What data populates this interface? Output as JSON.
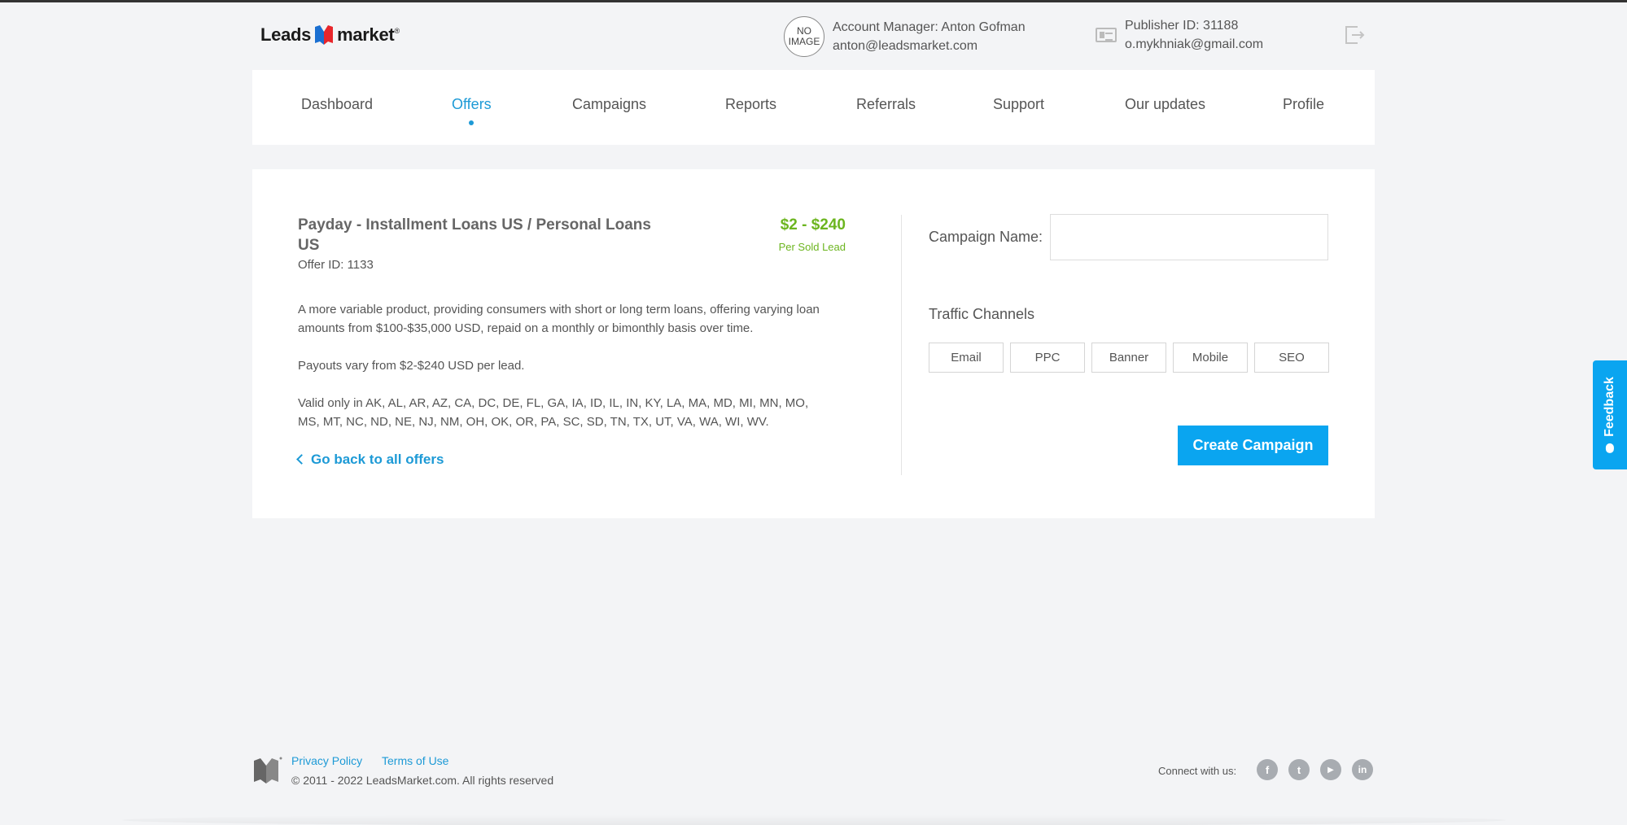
{
  "header": {
    "logo_left": "Leads",
    "logo_right": "market",
    "logo_reg": "®",
    "avatar_text": "NO IMAGE",
    "account_manager": "Account Manager: Anton Gofman",
    "manager_email": "anton@leadsmarket.com",
    "publisher_id": "Publisher ID: 31188",
    "publisher_email": "o.mykhniak@gmail.com"
  },
  "nav": {
    "items": [
      "Dashboard",
      "Offers",
      "Campaigns",
      "Reports",
      "Referrals",
      "Support",
      "Our updates",
      "Profile"
    ],
    "active": "Offers"
  },
  "offer": {
    "title": "Payday - Installment Loans US / Personal Loans US",
    "offer_id": "Offer ID: 1133",
    "price": "$2 - $240",
    "price_sub": "Per Sold Lead",
    "description": "A more variable product, providing consumers with short or long term loans, offering varying loan amounts from $100-$35,000 USD, repaid on a monthly or bimonthly basis over time.",
    "payouts": "Payouts vary from $2-$240 USD per lead.",
    "valid": "Valid only in AK, AL, AR, AZ, CA, DC, DE, FL, GA, IA, ID, IL, IN, KY, LA, MA, MD, MI, MN, MO, MS, MT, NC, ND, NE, NJ, NM, OH, OK, OR, PA, SC, SD, TN, TX, UT, VA, WA, WI, WV.",
    "back_link": "Go back to all offers"
  },
  "campaign": {
    "name_label": "Campaign Name:",
    "name_value": "",
    "traffic_label": "Traffic Channels",
    "channels": [
      "Email",
      "PPC",
      "Banner",
      "Mobile",
      "SEO"
    ],
    "create_button": "Create Campaign"
  },
  "feedback_label": "Feedback",
  "footer": {
    "privacy": "Privacy Policy",
    "terms": "Terms of Use",
    "copyright": "© 2011 - 2022 LeadsMarket.com. All rights reserved",
    "connect": "Connect with us:",
    "social": [
      {
        "name": "facebook",
        "glyph": "f"
      },
      {
        "name": "twitter",
        "glyph": "t"
      },
      {
        "name": "youtube",
        "glyph": "▶"
      },
      {
        "name": "linkedin",
        "glyph": "in"
      }
    ]
  },
  "colors": {
    "accent": "#1d9ad6",
    "button": "#0aa5f0",
    "price": "#6cb51f",
    "brand_red": "#e8262b",
    "brand_blue": "#1a6fd1"
  }
}
